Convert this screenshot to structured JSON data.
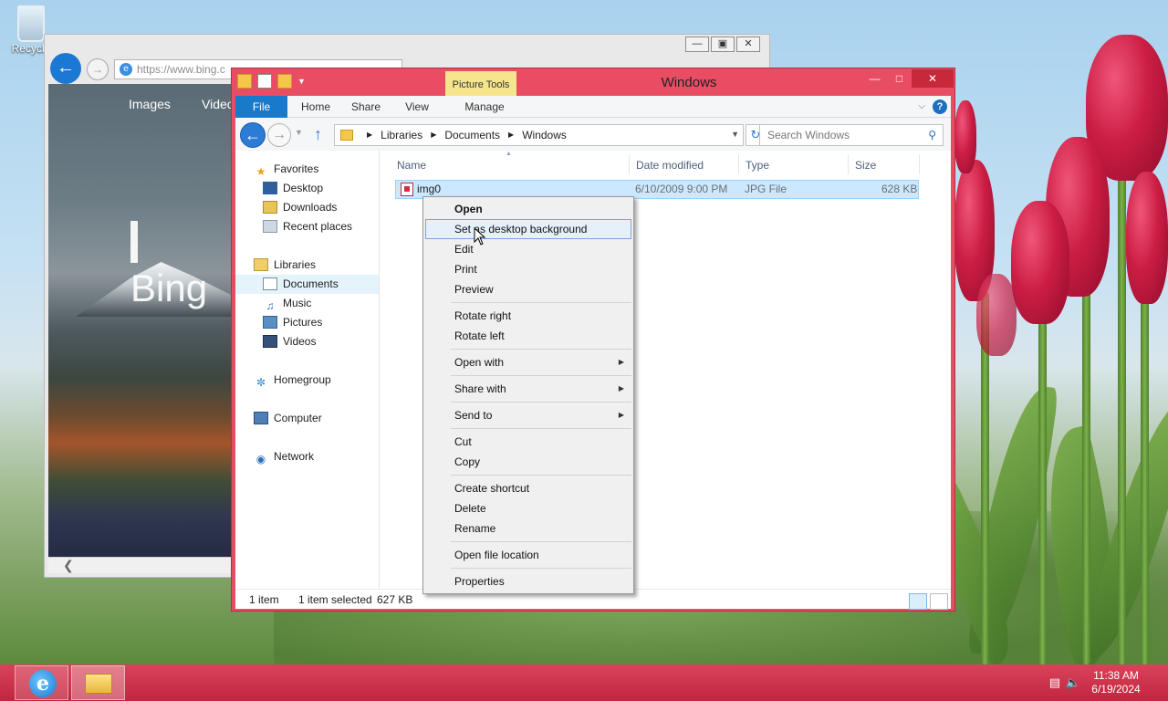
{
  "desktop": {
    "recycle_label": "Recycle"
  },
  "browser": {
    "address": "https://www.bing.c",
    "nav_items": [
      "Images",
      "Video"
    ],
    "logo": "Bing",
    "title_buttons": [
      "minimize-icon",
      "restore-icon",
      "close-icon"
    ]
  },
  "explorer": {
    "title": "Windows",
    "contextual_tab": "Picture Tools",
    "ribbon_tabs": [
      "File",
      "Home",
      "Share",
      "View",
      "Manage"
    ],
    "breadcrumb": [
      "Libraries",
      "Documents",
      "Windows"
    ],
    "search_placeholder": "Search Windows",
    "nav_pane": {
      "favorites": {
        "label": "Favorites",
        "items": [
          "Desktop",
          "Downloads",
          "Recent places"
        ]
      },
      "libraries": {
        "label": "Libraries",
        "items": [
          "Documents",
          "Music",
          "Pictures",
          "Videos"
        ]
      },
      "homegroup": "Homegroup",
      "computer": "Computer",
      "network": "Network"
    },
    "columns": {
      "name": "Name",
      "date": "Date modified",
      "type": "Type",
      "size": "Size"
    },
    "files": [
      {
        "name": "img0",
        "date": "6/10/2009 9:00 PM",
        "type": "JPG File",
        "size": "628 KB"
      }
    ],
    "status": {
      "count": "1 item",
      "selected": "1 item selected",
      "size": "627 KB"
    }
  },
  "context_menu": {
    "items": [
      {
        "label": "Open",
        "bold": true
      },
      {
        "label": "Set as desktop background",
        "hover": true
      },
      {
        "label": "Edit"
      },
      {
        "label": "Print"
      },
      {
        "label": "Preview"
      },
      {
        "label": "Rotate right"
      },
      {
        "label": "Rotate left"
      },
      {
        "label": "Open with",
        "submenu": true
      },
      {
        "label": "Share with",
        "submenu": true
      },
      {
        "label": "Send to",
        "submenu": true
      },
      {
        "label": "Cut"
      },
      {
        "label": "Copy"
      },
      {
        "label": "Create shortcut"
      },
      {
        "label": "Delete"
      },
      {
        "label": "Rename"
      },
      {
        "label": "Open file location"
      },
      {
        "label": "Properties"
      }
    ]
  },
  "taskbar": {
    "pinned": [
      "internet-explorer",
      "file-explorer"
    ],
    "time": "11:38 AM",
    "date": "6/19/2024"
  }
}
